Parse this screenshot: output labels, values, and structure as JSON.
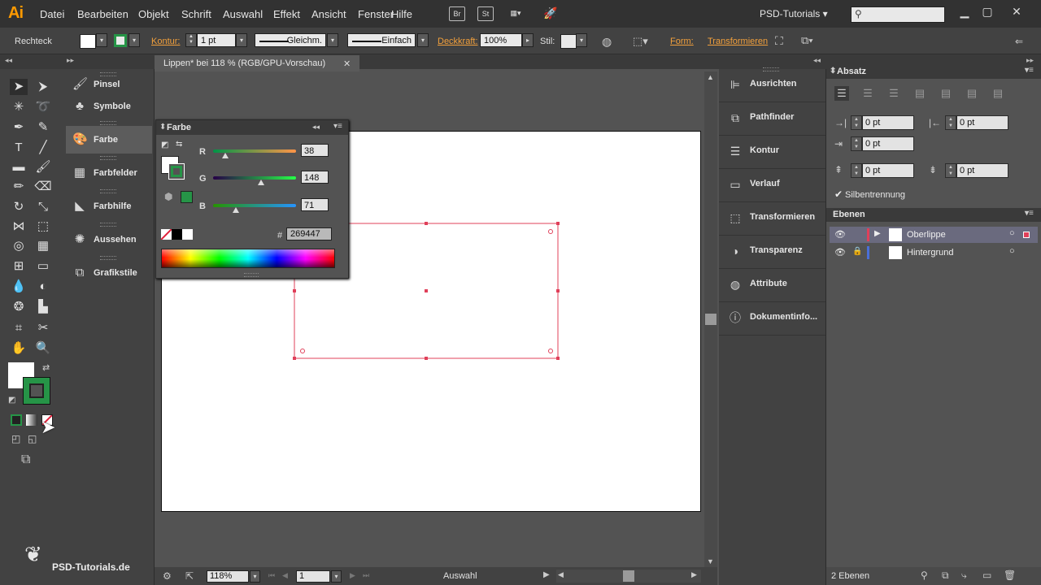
{
  "app": {
    "logo": "Ai"
  },
  "menu": [
    "Datei",
    "Bearbeiten",
    "Objekt",
    "Schrift",
    "Auswahl",
    "Effekt",
    "Ansicht",
    "Fenster",
    "Hilfe"
  ],
  "menu_icons": {
    "br": "Br",
    "st": "St"
  },
  "workspace": "PSD-Tutorials",
  "control": {
    "object_type": "Rechteck",
    "stroke_label": "Kontur:",
    "stroke_weight": "1 pt",
    "profile": "Gleichm.",
    "brush": "Einfach",
    "opacity_label": "Deckkraft:",
    "opacity": "100%",
    "style_label": "Stil:",
    "shape_label": "Form:",
    "transform_label": "Transformieren"
  },
  "dock1": [
    "Pinsel",
    "Symbole",
    "Farbe",
    "Farbfelder",
    "Farbhilfe",
    "Aussehen",
    "Grafikstile"
  ],
  "document": {
    "tab_title": "Lippen* bei 118 % (RGB/GPU-Vorschau)"
  },
  "color_panel": {
    "title": "Farbe",
    "r_label": "R",
    "g_label": "G",
    "b_label": "B",
    "r": 38,
    "g": 148,
    "b": 71,
    "r_max": 255,
    "hex_label": "#",
    "hex": "269447",
    "fill_color": "#ffffff",
    "stroke_color": "#269447"
  },
  "dock2": [
    "Ausrichten",
    "Pathfinder",
    "Kontur",
    "Verlauf",
    "Transformieren",
    "Transparenz",
    "Attribute",
    "Dokumentinfo..."
  ],
  "absatz": {
    "title": "Absatz",
    "left_indent": "0 pt",
    "right_indent": "0 pt",
    "first_line": "0 pt",
    "space_before": "0 pt",
    "space_after": "0 pt",
    "hyphenation_label": "Silbentrennung"
  },
  "layers": {
    "title": "Ebenen",
    "items": [
      {
        "name": "Oberlippe",
        "color": "#e0405a"
      },
      {
        "name": "Hintergrund",
        "color": "#4a6fd8"
      }
    ],
    "count": "2 Ebenen"
  },
  "status": {
    "zoom": "118%",
    "page": "1",
    "mode": "Auswahl"
  },
  "watermark": "PSD-Tutorials.de",
  "colors": {
    "accent_green": "#269447",
    "selection": "#e0405a"
  }
}
